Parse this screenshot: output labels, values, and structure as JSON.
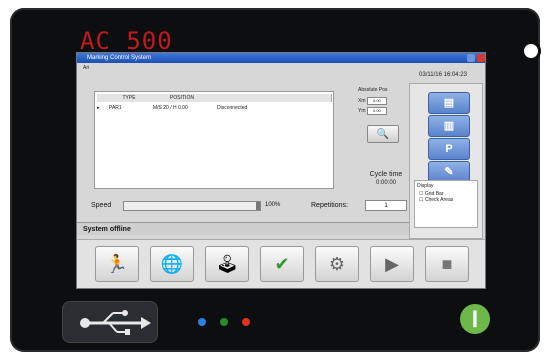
{
  "device": {
    "brand": "AC 500"
  },
  "window": {
    "title": "Marking Control System",
    "menu": "Ari"
  },
  "datetime": "03/11/16 16:04:23",
  "table": {
    "headers": [
      "",
      "TYPE",
      "POSITION",
      ""
    ],
    "rows": [
      [
        "▸",
        "PAR1",
        "M/S 20 / H 0.00",
        "Disconnected"
      ]
    ]
  },
  "position_group": {
    "title": "Absolute Pos",
    "x_label": "Xm",
    "x_value": "0.00",
    "y_label": "Ym",
    "y_value": "0.00"
  },
  "cycle_time": {
    "label": "Cycle time",
    "value": "0:00:00"
  },
  "speed": {
    "label": "Speed",
    "percent": "100%",
    "level": 1.0
  },
  "repetitions": {
    "label": "Repetitions:",
    "value": "1"
  },
  "status": {
    "text": "System offline"
  },
  "right_panel": {
    "buttons": [
      "new-file-icon",
      "open-file-icon",
      "p-icon",
      "settings-icon"
    ],
    "p_label": "P",
    "display_title": "Display",
    "display_opt1": "Grid Bar",
    "display_opt2": "Check Areas"
  },
  "toolbar": {
    "icons": [
      "run-person-icon",
      "globe-icon",
      "joystick-icon",
      "check-icon",
      "marking-tool-icon",
      "play-icon",
      "stop-icon"
    ],
    "glyphs": [
      "🏃",
      "🌐",
      "🕹",
      "✔",
      "⚙",
      "▶",
      "■"
    ]
  },
  "colors": {
    "brand_red": "#c2191b",
    "titlebar_blue": "#1b4fb4",
    "led_blue": "#2f7fe0",
    "led_green": "#2c8a2a",
    "led_red": "#e03020",
    "power_green": "#6db848"
  }
}
